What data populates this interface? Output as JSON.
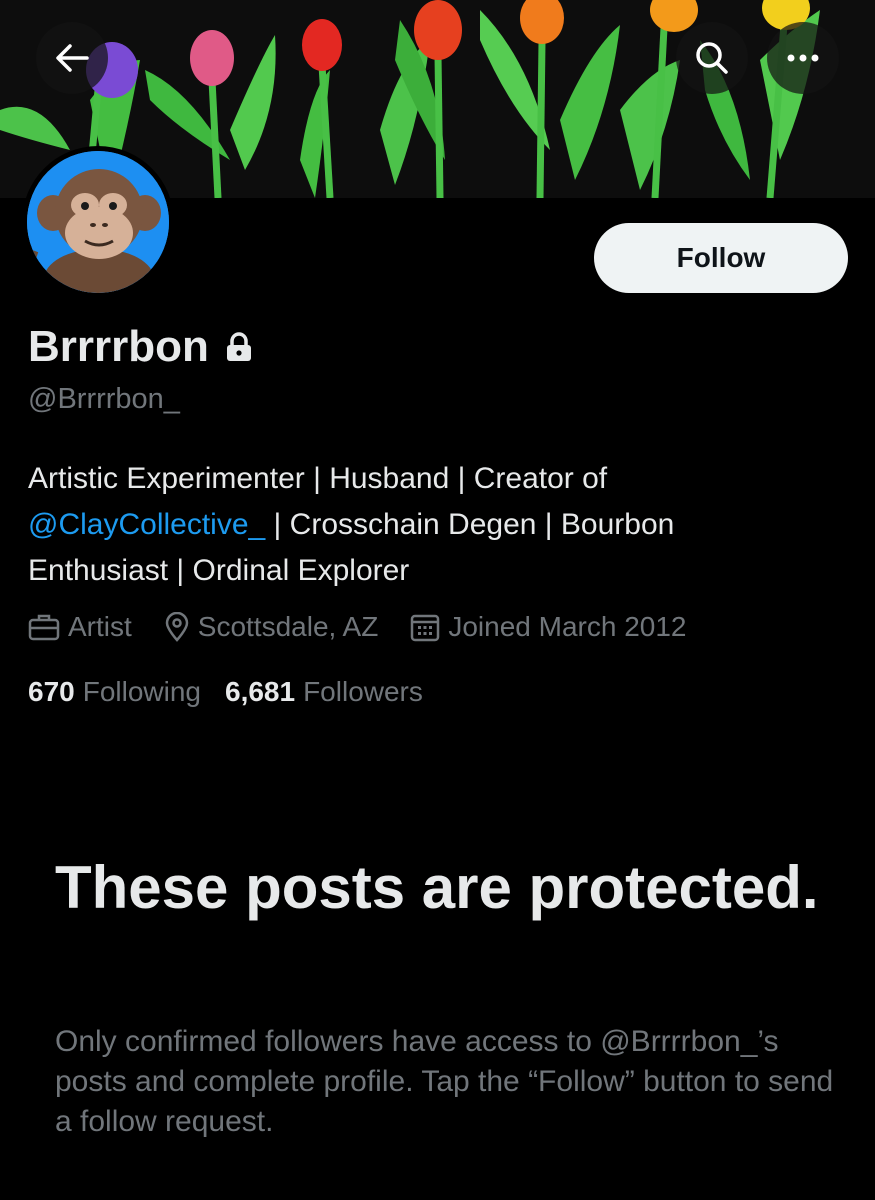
{
  "header": {
    "back_icon": "arrow-left-icon",
    "search_icon": "search-icon",
    "more_icon": "more-horizontal-icon"
  },
  "profile": {
    "display_name": "Brrrrbon",
    "lock_icon": "lock-icon",
    "handle": "@Brrrrbon_",
    "follow_label": "Follow",
    "bio": {
      "line1": "Artistic Experimenter | Husband | Creator of",
      "mention": "@ClayCollective_",
      "line2_rest": " | Crosschain Degen | Bourbon",
      "line3": "Enthusiast | Ordinal Explorer"
    },
    "meta": {
      "profession": "Artist",
      "location": "Scottsdale, AZ",
      "joined": "Joined March 2012"
    },
    "stats": {
      "following_count": "670",
      "following_label": "Following",
      "followers_count": "6,681",
      "followers_label": "Followers"
    }
  },
  "protected": {
    "title": "These posts are protected.",
    "description": "Only confirmed followers have access to @Brrrrbon_’s posts and complete profile. Tap the “Follow” button to send a follow request."
  },
  "colors": {
    "background": "#000000",
    "text_primary": "#e7e9ea",
    "text_secondary": "#71767b",
    "link": "#1d9bf0",
    "follow_button_bg": "#eff3f4"
  }
}
